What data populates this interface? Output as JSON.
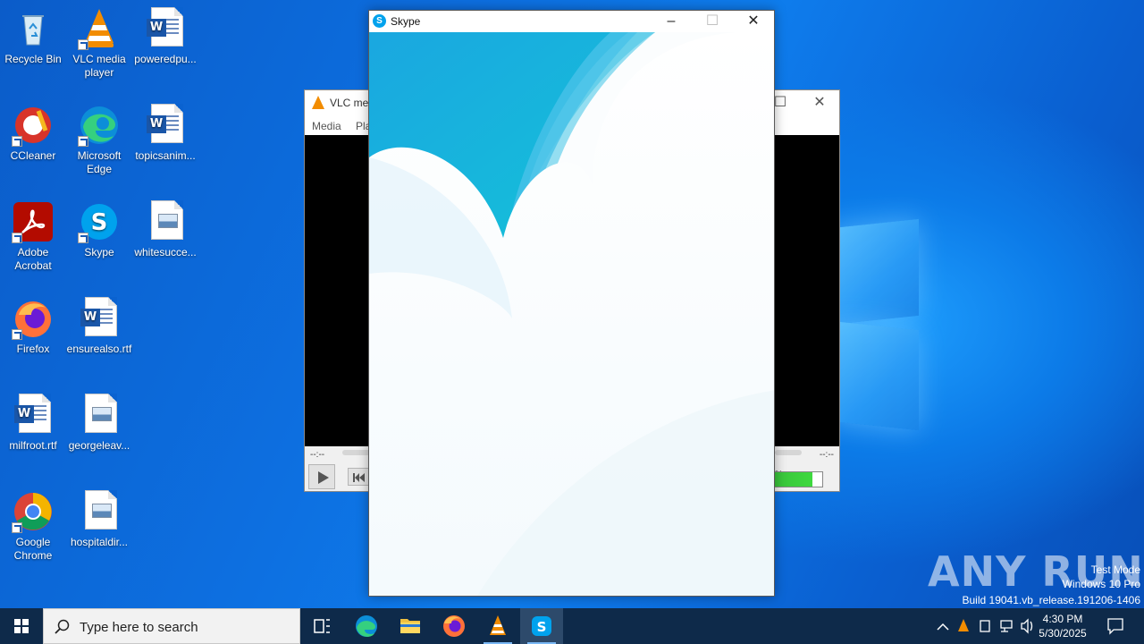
{
  "desktop": {
    "icons": [
      {
        "label": "Recycle Bin"
      },
      {
        "label": "VLC media player"
      },
      {
        "label": "poweredpu..."
      },
      {
        "label": "CCleaner"
      },
      {
        "label": "Microsoft Edge"
      },
      {
        "label": "topicsanim..."
      },
      {
        "label": "Adobe Acrobat"
      },
      {
        "label": "Skype"
      },
      {
        "label": "whitesucce..."
      },
      {
        "label": "Firefox"
      },
      {
        "label": "ensurealso.rtf"
      },
      {
        "label": "milfroot.rtf"
      },
      {
        "label": "georgeleav..."
      },
      {
        "label": "Google Chrome"
      },
      {
        "label": "hospitaldir..."
      }
    ]
  },
  "vlc": {
    "title": "VLC me",
    "menu": [
      "Media",
      "Pla"
    ],
    "time_left": "--:--",
    "time_right": "--:--",
    "volume_text": "%",
    "accent": "#f28c00"
  },
  "skype": {
    "title": "Skype",
    "accent": "#00a2ed"
  },
  "taskbar": {
    "search_placeholder": "Type here to search",
    "time": "4:30 PM",
    "date": "5/30/2025"
  },
  "watermark": {
    "line1": "Test Mode",
    "line2": "Windows 10 Pro",
    "line3": "Build 19041.vb_release.191206-1406",
    "brand": "ANY RUN"
  }
}
